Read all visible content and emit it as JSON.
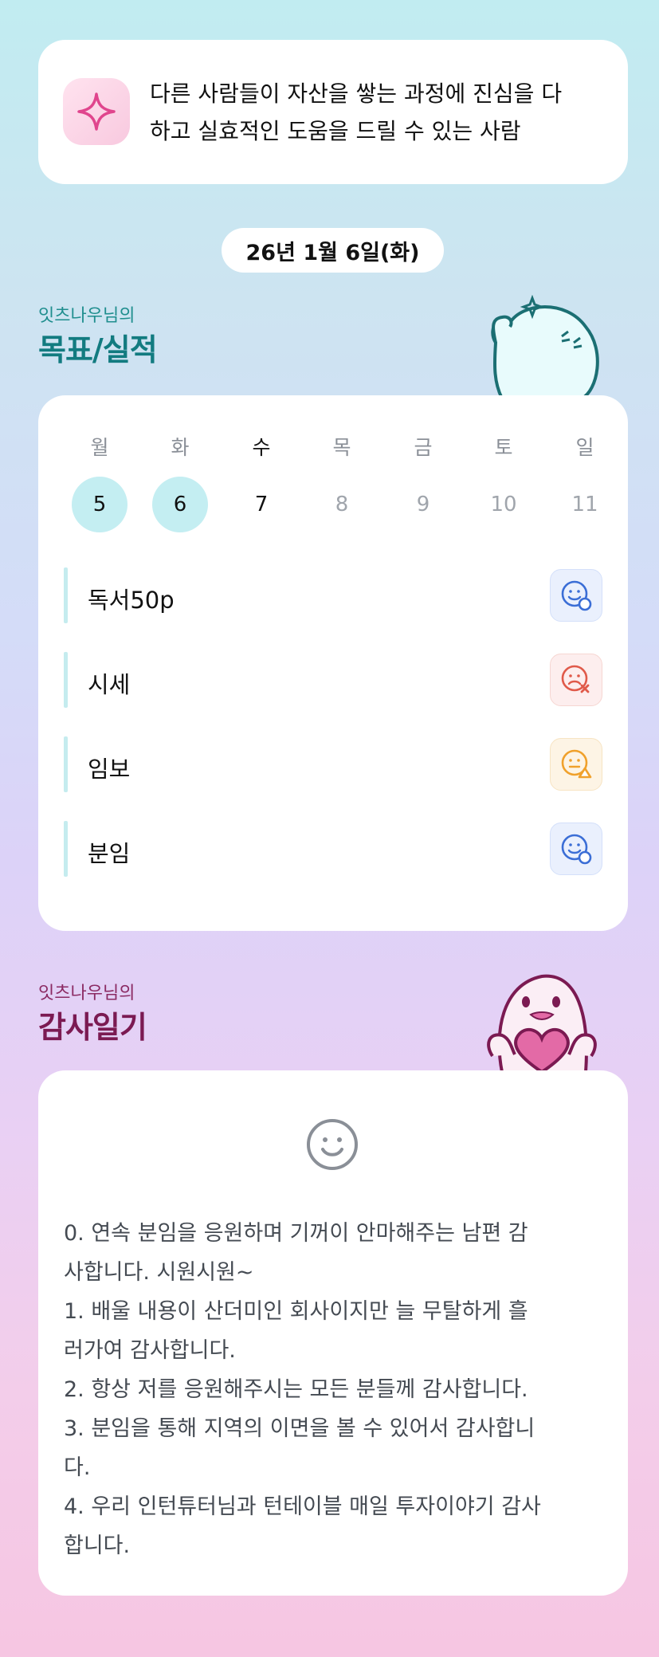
{
  "motto": {
    "icon": "sparkle-icon",
    "line1": "다른 사람들이 자산을 쌓는 과정에 진심을 다",
    "line2": "하고 실효적인 도움을 드릴 수 있는 사람"
  },
  "date": "26년 1월 6일(화)",
  "goals": {
    "owner": "잇츠나우님의",
    "title": "목표/실적",
    "weekdays": [
      "월",
      "화",
      "수",
      "목",
      "금",
      "토",
      "일"
    ],
    "days": [
      "5",
      "6",
      "7",
      "8",
      "9",
      "10",
      "11"
    ],
    "tasks": [
      {
        "label": "독서50p",
        "status": "done",
        "icon": "smile-check-icon",
        "color": "#3b6ed6"
      },
      {
        "label": "시세",
        "status": "failed",
        "icon": "frown-x-icon",
        "color": "#e05a4a"
      },
      {
        "label": "임보",
        "status": "partial",
        "icon": "meh-warning-icon",
        "color": "#f0a12c"
      },
      {
        "label": "분임",
        "status": "done",
        "icon": "smile-check-icon",
        "color": "#3b6ed6"
      }
    ]
  },
  "thanks": {
    "owner": "잇츠나우님의",
    "title": "감사일기",
    "lines": [
      "0. 연속 분임을 응원하며 기꺼이 안마해주는 남편 감",
      "사합니다. 시원시원~",
      "1. 배울 내용이 산더미인 회사이지만 늘 무탈하게 흘",
      "러가여 감사합니다.",
      "2. 항상 저를 응원해주시는 모든 분들께 감사합니다.",
      "3. 분임을 통해 지역의 이면을 볼 수 있어서 감사합니",
      "다.",
      "4. 우리 인턴튜터님과 턴테이블 매일 투자이야기 감사",
      "합니다."
    ]
  }
}
